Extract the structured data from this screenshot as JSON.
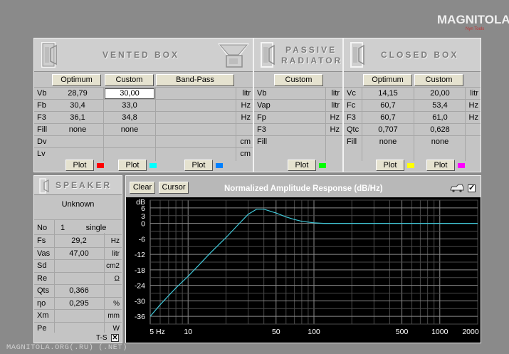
{
  "logo": {
    "text": "MAGNITOLA",
    "subtitle": "Nyn Tools"
  },
  "footer": {
    "text": "MAGNITOLA.ORG(.RU) (.NET)"
  },
  "vented": {
    "title": "VENTED BOX",
    "buttons": {
      "optimum": "Optimum",
      "custom": "Custom",
      "bandpass": "Band-Pass"
    },
    "rows": [
      {
        "label": "Vb",
        "opt": "28,79",
        "cus": "30,00",
        "unit": "litr"
      },
      {
        "label": "Fb",
        "opt": "30,4",
        "cus": "33,0",
        "unit": "Hz"
      },
      {
        "label": "F3",
        "opt": "36,1",
        "cus": "34,8",
        "unit": "Hz"
      },
      {
        "label": "Fill",
        "opt": "none",
        "cus": "none",
        "unit": ""
      },
      {
        "label": "Dv",
        "opt": "",
        "cus": "",
        "unit": "cm"
      },
      {
        "label": "Lv",
        "opt": "",
        "cus": "",
        "unit": "cm"
      }
    ],
    "plot_label": "Plot",
    "plot_colors": [
      "#ff0000",
      "#00ffff",
      "#0080ff"
    ]
  },
  "passive": {
    "title_line1": "PASSIVE",
    "title_line2": "RADIATOR",
    "custom": "Custom",
    "rows": [
      {
        "label": "Vb",
        "unit": "litr"
      },
      {
        "label": "Vap",
        "unit": "litr"
      },
      {
        "label": "Fp",
        "unit": "Hz"
      },
      {
        "label": "F3",
        "unit": "Hz"
      },
      {
        "label": "Fill",
        "unit": ""
      }
    ],
    "plot_label": "Plot",
    "plot_color": "#00ff00"
  },
  "closed": {
    "title": "CLOSED BOX",
    "buttons": {
      "optimum": "Optimum",
      "custom": "Custom"
    },
    "rows": [
      {
        "label": "Vc",
        "opt": "14,15",
        "cus": "20,00",
        "unit": "litr"
      },
      {
        "label": "Fc",
        "opt": "60,7",
        "cus": "53,4",
        "unit": "Hz"
      },
      {
        "label": "F3",
        "opt": "60,7",
        "cus": "61,0",
        "unit": "Hz"
      },
      {
        "label": "Qtc",
        "opt": "0,707",
        "cus": "0,628",
        "unit": ""
      },
      {
        "label": "Fill",
        "opt": "none",
        "cus": "none",
        "unit": ""
      }
    ],
    "plot_label": "Plot",
    "plot_colors": [
      "#ffff00",
      "#ff00ff"
    ]
  },
  "speaker": {
    "title": "SPEAKER",
    "name": "Unknown",
    "no_label": "No",
    "no_value": "1",
    "mode": "single",
    "rows": [
      {
        "label": "Fs",
        "value": "29,2",
        "unit": "Hz"
      },
      {
        "label": "Vas",
        "value": "47,00",
        "unit": "litr"
      },
      {
        "label": "Sd",
        "value": "",
        "unit": "cm2"
      },
      {
        "label": "Re",
        "value": "",
        "unit": "Ω"
      },
      {
        "label": "Qts",
        "value": "0,366",
        "unit": ""
      },
      {
        "label": "ηo",
        "value": "0,295",
        "unit": "%"
      },
      {
        "label": "Xm",
        "value": "",
        "unit": "mm"
      },
      {
        "label": "Pe",
        "value": "",
        "unit": "W"
      }
    ],
    "ts_label": "T-S"
  },
  "graph": {
    "clear": "Clear",
    "cursor": "Cursor",
    "title": "Normalized Amplitude Response (dB/Hz)",
    "checkbox_checked": true
  },
  "chart_data": {
    "type": "line",
    "title": "Normalized Amplitude Response (dB/Hz)",
    "ylabel": "dB",
    "xlabel": "Hz",
    "x_scale": "log",
    "xlim": [
      5,
      2000
    ],
    "ylim": [
      -39,
      9
    ],
    "yticks": [
      "dB",
      "6",
      "3",
      "0",
      "-6",
      "-12",
      "-18",
      "-24",
      "-30",
      "-36"
    ],
    "xticks": [
      {
        "v": 5,
        "l": "5 Hz"
      },
      {
        "v": 10,
        "l": "10"
      },
      {
        "v": 50,
        "l": "50"
      },
      {
        "v": 100,
        "l": "100"
      },
      {
        "v": 500,
        "l": "500"
      },
      {
        "v": 1000,
        "l": "1000"
      },
      {
        "v": 2000,
        "l": "2000"
      }
    ],
    "grid": true,
    "series": [
      {
        "color": "#40c8d8",
        "x": [
          5,
          6,
          7,
          8,
          10,
          12,
          15,
          20,
          25,
          30,
          35,
          40,
          50,
          60,
          70,
          80,
          100,
          120,
          200,
          500,
          1000,
          2000
        ],
        "y": [
          -36,
          -31.5,
          -28,
          -25,
          -20.5,
          -16.5,
          -11.5,
          -5.5,
          -0.5,
          3.5,
          5.5,
          5.5,
          4,
          2.5,
          1.5,
          0.8,
          0.2,
          0,
          0,
          0,
          0,
          0
        ]
      }
    ]
  }
}
